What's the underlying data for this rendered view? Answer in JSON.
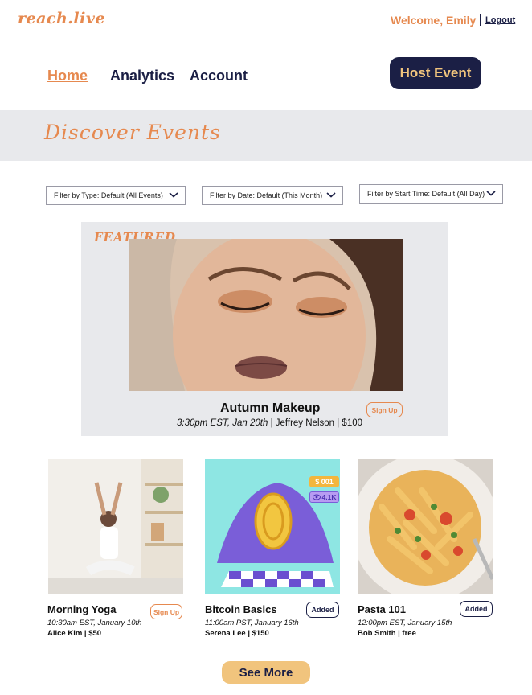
{
  "header": {
    "logo": "reach.live",
    "welcome": "Welcome, Emily",
    "logout": "Logout"
  },
  "nav": {
    "home": "Home",
    "analytics": "Analytics",
    "account": "Account",
    "host_event": "Host Event"
  },
  "banner": {
    "title": "Discover Events"
  },
  "filters": [
    {
      "label": "Filter by Type:",
      "value": "Default (All Events)"
    },
    {
      "label": "Filter by Date:",
      "value": "Default (This Month)"
    },
    {
      "label": "Filter by Start Time:",
      "value": "Default (All Day)"
    }
  ],
  "featured": {
    "tag": "FEATURED",
    "title": "Autumn Makeup",
    "time": "3:30pm EST, Jan 20th",
    "host_price": " | Jeffrey Nelson | $100",
    "action": "Sign Up"
  },
  "cards": [
    {
      "title": "Morning Yoga",
      "time": "10:30am EST, January 10th",
      "host": "Alice Kim | $50",
      "action": "Sign Up"
    },
    {
      "title": "Bitcoin Basics",
      "time": "11:00am PST, January 16th",
      "host": "Serena Lee | $150",
      "action": "Added",
      "badge_price": "$ 001",
      "badge_views": "4.1K"
    },
    {
      "title": "Pasta 101",
      "time": "12:00pm EST, January 15th",
      "host": "Bob Smith | free",
      "action": "Added"
    }
  ],
  "see_more": "See More",
  "colors": {
    "accent": "#e6894f",
    "navy": "#1b1f45",
    "gold": "#f1c47d",
    "banner": "#e8e9ec"
  },
  "icons": [
    "chevron-down-icon",
    "eye-icon",
    "coin-icon"
  ]
}
